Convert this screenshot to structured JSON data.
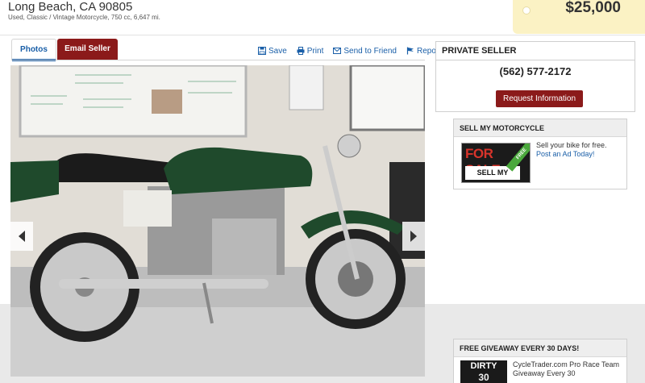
{
  "header": {
    "location": "Long Beach, CA 90805",
    "subline": "Used, Classic / Vintage Motorcycle, 750 cc, 6,647 mi.",
    "price": "$25,000"
  },
  "tabs": [
    {
      "label": "Photos",
      "active": true
    },
    {
      "label": "Email Seller",
      "active": false
    }
  ],
  "actions": [
    {
      "label": "Save",
      "icon": "save-icon"
    },
    {
      "label": "Print",
      "icon": "print-icon"
    },
    {
      "label": "Send to Friend",
      "icon": "mail-icon"
    },
    {
      "label": "Report",
      "icon": "flag-icon"
    }
  ],
  "seller": {
    "title": "PRIVATE SELLER",
    "phone": "(562) 577-2172",
    "button": "Request Information"
  },
  "sell_promo": {
    "title": "SELL MY MOTORCYCLE",
    "badge_top": "FOR SALE",
    "badge_bottom": "SELL MY CYCLE",
    "badge_ribbon": "FREE",
    "text": "Sell your bike for free.",
    "link": "Post an Ad Today!"
  },
  "giveaway": {
    "title": "FREE GIVEAWAY EVERY 30 DAYS!",
    "badge_line1": "DIRTY",
    "badge_line2": "30",
    "text": "CycleTrader.com Pro Race Team Giveaway Every 30"
  },
  "colors": {
    "accent_red": "#8b1a1a",
    "link_blue": "#1a5fa8",
    "price_tag": "#fbf2c4",
    "bike_green": "#1f4a2c"
  }
}
